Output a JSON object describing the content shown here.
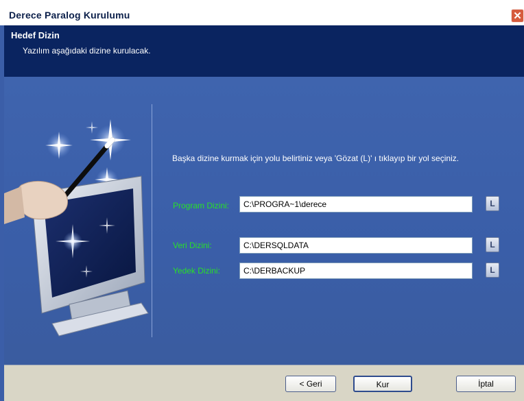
{
  "window": {
    "title": "Derece Paralog Kurulumu",
    "close_glyph": "✕"
  },
  "header": {
    "title": "Hedef Dizin",
    "subtitle": "Yazılım aşağıdaki dizine kurulacak."
  },
  "main": {
    "instruction": "Başka dizine kurmak için yolu belirtiniz veya 'Gözat (L)' ı tıklayıp bir yol seçiniz.",
    "fields": [
      {
        "label": "Program Dizini:",
        "value": "C:\\PROGRA~1\\derece",
        "browse_glyph": "L"
      },
      {
        "label": "Veri Dizini:",
        "value": "C:\\DERSQLDATA",
        "browse_glyph": "L"
      },
      {
        "label": "Yedek Dizini:",
        "value": "C:\\DERBACKUP",
        "browse_glyph": "L"
      }
    ],
    "label_color": "#28e028"
  },
  "footer": {
    "back_label": "< Geri",
    "next_label": "Kur",
    "cancel_label": "İptal"
  }
}
